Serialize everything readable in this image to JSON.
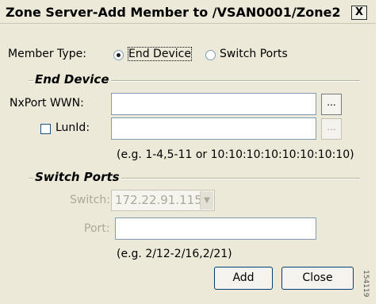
{
  "window": {
    "title": "Zone Server-Add Member to /VSAN0001/Zone2",
    "close_label": "X"
  },
  "member_type": {
    "label": "Member Type:",
    "options": [
      {
        "label": "End Device",
        "selected": true
      },
      {
        "label": "Switch Ports",
        "selected": false
      }
    ]
  },
  "end_device": {
    "group_title": "End Device",
    "nxport_wwn_label": "NxPort WWN:",
    "nxport_wwn_value": "",
    "browse_label": "...",
    "lunid_label": "LunId:",
    "lunid_checked": false,
    "lunid_value": "",
    "lunid_browse_label": "...",
    "hint": "(e.g. 1-4,5-11 or 10:10:10:10:10:10:10:10)"
  },
  "switch_ports": {
    "group_title": "Switch Ports",
    "switch_label": "Switch:",
    "switch_value": "172.22.91.115",
    "port_label": "Port:",
    "port_value": "",
    "hint": "(e.g. 2/12-2/16,2/21)"
  },
  "actions": {
    "add_label": "Add",
    "close_label": "Close"
  },
  "figure_id": "154119",
  "colors": {
    "dialog_background": "#ece9d8",
    "input_border": "#7f9db9",
    "disabled_text": "#aca899",
    "button_border": "#003c74"
  }
}
